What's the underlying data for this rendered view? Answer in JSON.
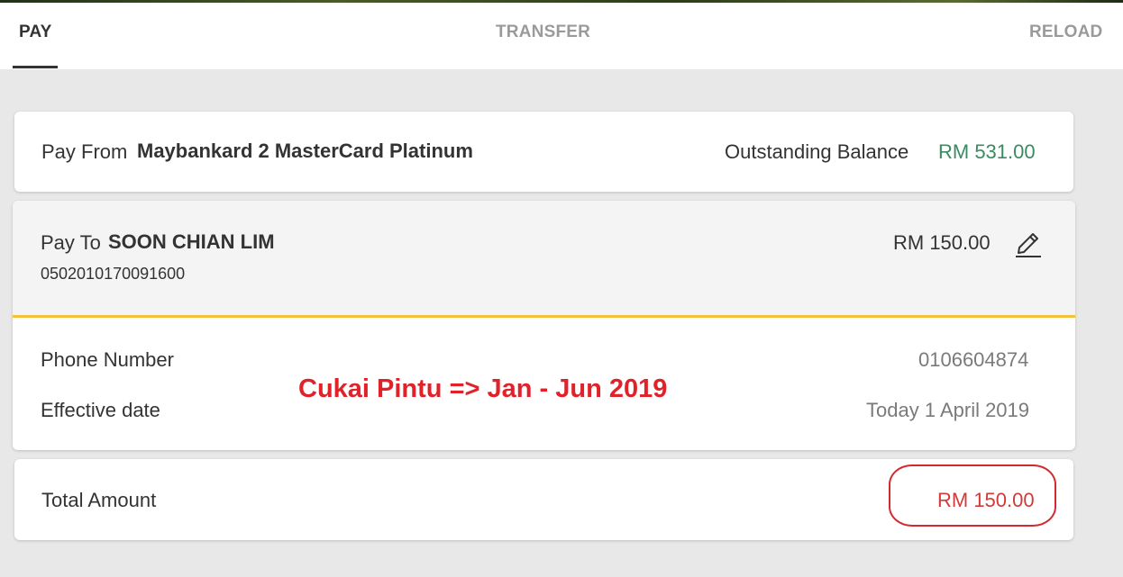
{
  "tabs": {
    "pay": "PAY",
    "transfer": "TRANSFER",
    "reload": "RELOAD"
  },
  "pay_from": {
    "label": "Pay From",
    "account": "Maybankard 2 MasterCard Platinum",
    "balance_label": "Outstanding Balance",
    "balance_value": "RM 531.00"
  },
  "pay_to": {
    "label": "Pay To",
    "name": "SOON CHIAN LIM",
    "account_number": "0502010170091600",
    "amount": "RM 150.00",
    "edit_icon": "pencil-icon"
  },
  "details": {
    "phone_label": "Phone Number",
    "phone_value": "0106604874",
    "date_label": "Effective date",
    "date_value": "Today 1 April 2019"
  },
  "total": {
    "label": "Total Amount",
    "value": "RM 150.00"
  },
  "annotation": {
    "text": "Cukai Pintu => Jan - Jun 2019",
    "color": "#e0232b"
  },
  "colors": {
    "balance_green": "#3a8a62",
    "total_red": "#d23a3a",
    "divider_yellow": "#f2c23d"
  }
}
